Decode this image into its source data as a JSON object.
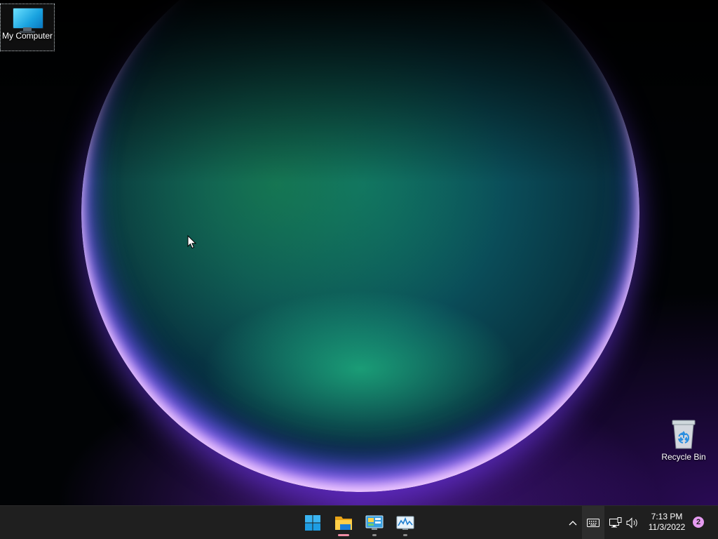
{
  "desktop": {
    "icons": [
      {
        "label": "My Computer",
        "icon": "monitor-icon",
        "selected": true
      },
      {
        "label": "Recycle Bin",
        "icon": "recycle-bin-icon",
        "selected": false
      }
    ]
  },
  "taskbar": {
    "apps": [
      {
        "name": "Start",
        "icon": "windows-start-icon",
        "running": false
      },
      {
        "name": "File Explorer",
        "icon": "folder-icon",
        "running": true,
        "active": true
      },
      {
        "name": "Control Panel",
        "icon": "control-panel-icon",
        "running": true,
        "active": false
      },
      {
        "name": "Performance Monitor",
        "icon": "performance-chart-icon",
        "running": true,
        "active": false
      }
    ],
    "tray": {
      "show_hidden_icon": "chevron-up-icon",
      "keyboard_icon": "keyboard-icon",
      "network_icon": "network-icon",
      "volume_icon": "speaker-icon",
      "time": "7:13 PM",
      "date": "11/3/2022",
      "notification_count": "2"
    }
  },
  "colors": {
    "taskbar_bg": "#1f1f1f",
    "active_indicator": "#f08ca4",
    "notification_badge": "#e59bf0"
  }
}
